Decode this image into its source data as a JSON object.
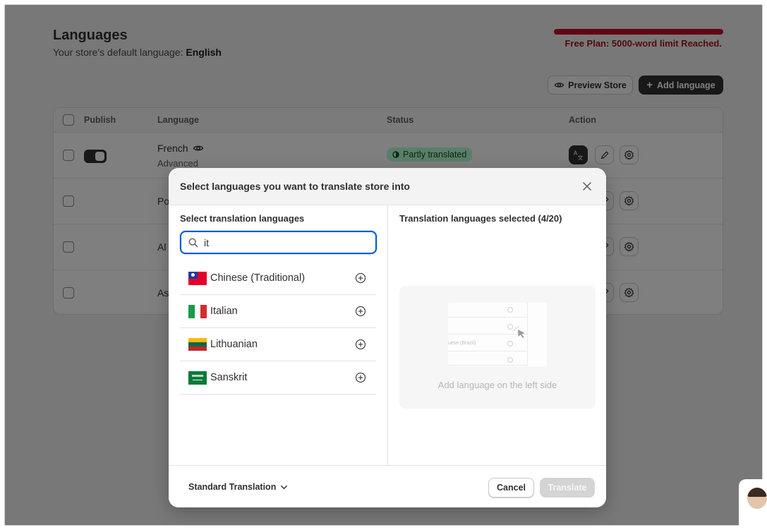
{
  "page": {
    "title": "Languages",
    "default_language_label": "Your store’s default language:",
    "default_language": "English",
    "plan_notice": "Free Plan: 5000-word limit Reached.",
    "preview_button": "Preview Store",
    "add_language_button": "Add language"
  },
  "table": {
    "headers": {
      "publish": "Publish",
      "language": "Language",
      "status": "Status",
      "action": "Action"
    },
    "rows": [
      {
        "language": "French",
        "sub": "Advanced",
        "status": "Partly translated",
        "published": true
      },
      {
        "language_partial": "Po"
      },
      {
        "language_partial": "Al"
      },
      {
        "language_partial": "As"
      }
    ]
  },
  "modal": {
    "title": "Select languages you want to translate store into",
    "left_label": "Select translation languages",
    "search_value": "it",
    "languages": [
      {
        "name": "Chinese (Traditional)",
        "flag": "taiwan-flag"
      },
      {
        "name": "Italian",
        "flag": "italy-flag"
      },
      {
        "name": "Lithuanian",
        "flag": "lithuania-flag"
      },
      {
        "name": "Sanskrit",
        "flag": "saudi-flag"
      }
    ],
    "right_label": "Translation languages selected (4/20)",
    "placeholder_text": "Add language on the left side",
    "placeholder_mini": "uese (Brazil)",
    "translation_mode": "Standard Translation",
    "cancel_button": "Cancel",
    "translate_button": "Translate"
  },
  "colors": {
    "accent": "#005bd3",
    "alert": "#c70a24",
    "badge_bg": "#b4fed2",
    "dark_button": "#303030"
  }
}
